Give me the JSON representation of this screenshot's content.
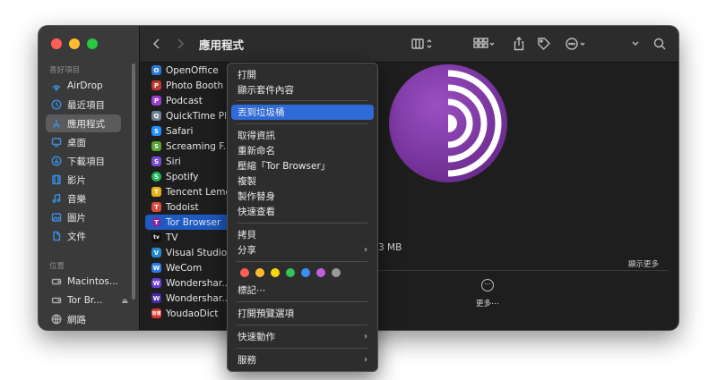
{
  "window": {
    "title": "應用程式",
    "traffic_lights": [
      "#ff5f57",
      "#febc2e",
      "#28c840"
    ]
  },
  "sidebar": {
    "favorites_header": "喜好項目",
    "favorites": [
      {
        "label": "AirDrop",
        "icon": "airdrop-icon"
      },
      {
        "label": "最近項目",
        "icon": "clock-icon"
      },
      {
        "label": "應用程式",
        "icon": "applications-icon",
        "active": true
      },
      {
        "label": "桌面",
        "icon": "desktop-icon"
      },
      {
        "label": "下載項目",
        "icon": "download-icon"
      },
      {
        "label": "影片",
        "icon": "film-icon"
      },
      {
        "label": "音樂",
        "icon": "music-icon"
      },
      {
        "label": "圖片",
        "icon": "photo-icon"
      },
      {
        "label": "文件",
        "icon": "document-icon"
      }
    ],
    "locations_header": "位置",
    "locations": [
      {
        "label": "Macintos...",
        "icon": "disk-icon"
      },
      {
        "label": "Tor Br...",
        "icon": "disk-icon",
        "eject": "⏏"
      },
      {
        "label": "網路",
        "icon": "network-icon"
      }
    ]
  },
  "files": [
    {
      "name": "OpenOffice",
      "color": "#2a7ad6",
      "glyph": "O"
    },
    {
      "name": "Photo Booth",
      "color": "#c0392b",
      "glyph": "P"
    },
    {
      "name": "Podcast",
      "color": "#9b3fd1",
      "glyph": "P"
    },
    {
      "name": "QuickTime Player",
      "color": "#6f7f95",
      "glyph": "Q"
    },
    {
      "name": "Safari",
      "color": "#1e90ff",
      "glyph": "S"
    },
    {
      "name": "Screaming F...",
      "color": "#55a630",
      "glyph": "S"
    },
    {
      "name": "Siri",
      "color": "#7b4bd8",
      "glyph": "S"
    },
    {
      "name": "Spotify",
      "color": "#1db954",
      "glyph": "S"
    },
    {
      "name": "Tencent Lemon",
      "color": "#e6b21a",
      "glyph": "T"
    },
    {
      "name": "Todoist",
      "color": "#db4c3f",
      "glyph": "T"
    },
    {
      "name": "Tor Browser",
      "color": "#7d2a9e",
      "glyph": "T",
      "selected": true
    },
    {
      "name": "TV",
      "color": "#111111",
      "glyph": "tv"
    },
    {
      "name": "Visual Studio Code",
      "color": "#1f8ad2",
      "glyph": "V"
    },
    {
      "name": "WeCom",
      "color": "#2b7de9",
      "glyph": "W"
    },
    {
      "name": "Wondershar...ite",
      "color": "#6b3cd6",
      "glyph": "W"
    },
    {
      "name": "Wondershar...ia",
      "color": "#4b2aa8",
      "glyph": "W"
    },
    {
      "name": "YoudaoDict",
      "color": "#d9342b",
      "glyph": "有道"
    }
  ],
  "preview": {
    "size_text": "3 MB",
    "show_more": "顯示更多",
    "more_caption": "更多⋯",
    "more_glyph": "⋯",
    "brand_color": "#7d4698"
  },
  "context_menu": {
    "group1": [
      "打開",
      "顯示套件內容"
    ],
    "group2": [
      "丟到垃圾桶"
    ],
    "group3": [
      "取得資訊",
      "重新命名",
      "壓縮「Tor Browser」",
      "複製",
      "製作替身",
      "快速查看"
    ],
    "group4": [
      {
        "label": "拷貝"
      },
      {
        "label": "分享",
        "submenu": true
      }
    ],
    "tag_colors": [
      "#ff5f57",
      "#febc2e",
      "#f5d90a",
      "#32c45a",
      "#3a8ff6",
      "#c05fe0",
      "#9a9a9a"
    ],
    "tags_label": "標記⋯",
    "group5": [
      "打開預覽選項"
    ],
    "group6": [
      {
        "label": "快速動作",
        "submenu": true
      }
    ],
    "group7": [
      {
        "label": "服務",
        "submenu": true
      }
    ],
    "submenu_arrow": "›"
  }
}
